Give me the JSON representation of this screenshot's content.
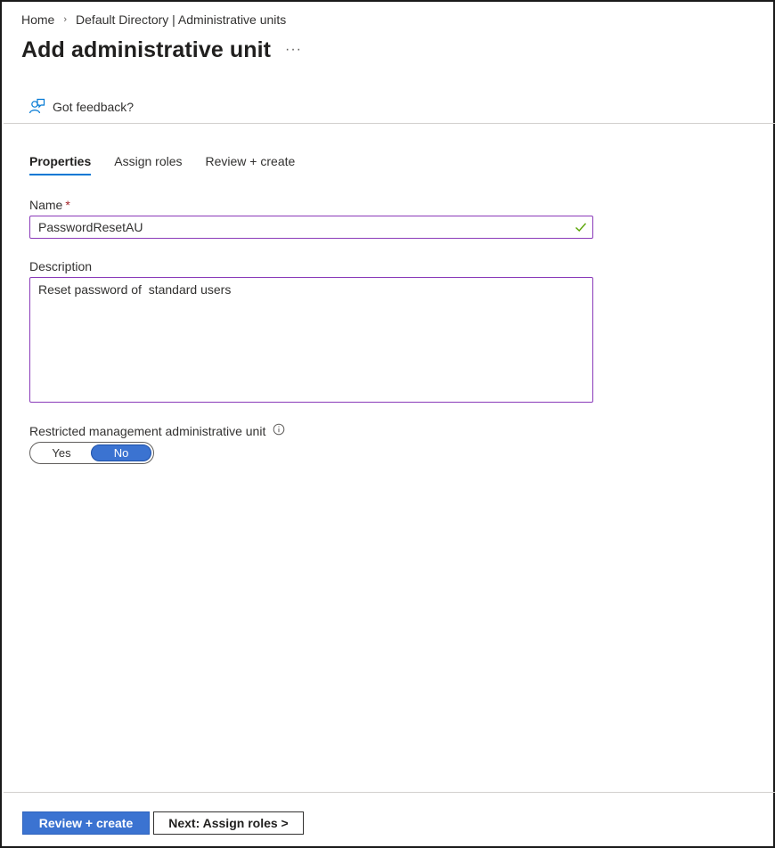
{
  "breadcrumb": {
    "home": "Home",
    "separator": "›",
    "current": "Default Directory | Administrative units"
  },
  "header": {
    "title": "Add administrative unit",
    "more_label": "···"
  },
  "feedback": {
    "label": "Got feedback?",
    "icon": "feedback-icon"
  },
  "tabs": [
    {
      "label": "Properties",
      "active": true
    },
    {
      "label": "Assign roles",
      "active": false
    },
    {
      "label": "Review + create",
      "active": false
    }
  ],
  "form": {
    "name_label": "Name",
    "required_marker": "*",
    "name_value": "PasswordResetAU",
    "description_label": "Description",
    "description_value": "Reset password of  standard users",
    "restricted_label": "Restricted management administrative unit",
    "toggle": {
      "yes": "Yes",
      "no": "No",
      "selected": "No"
    }
  },
  "footer": {
    "primary_label": "Review + create",
    "secondary_label": "Next: Assign roles >"
  },
  "colors": {
    "accent": "#0078d4",
    "primary_button": "#3b73d1",
    "input_border": "#8a3ab9",
    "success": "#57a300"
  }
}
